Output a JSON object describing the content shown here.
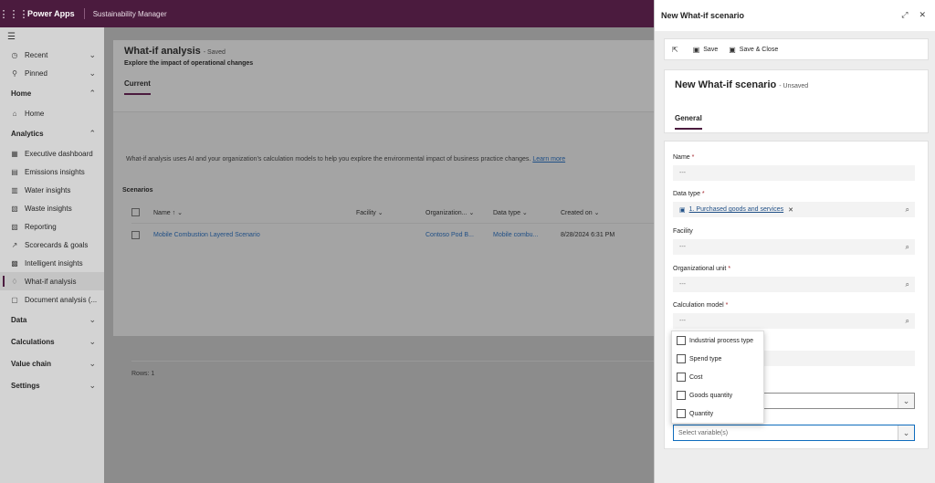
{
  "topbar": {
    "brand": "Power Apps",
    "app": "Sustainability Manager"
  },
  "sidebar": {
    "items": [
      {
        "label": "Recent",
        "icon": "clock-icon",
        "type": "item",
        "chevron": "⌄"
      },
      {
        "label": "Pinned",
        "icon": "pin-icon",
        "type": "item",
        "chevron": "⌄"
      },
      {
        "label": "Home",
        "type": "group",
        "chevron": "⌃"
      },
      {
        "label": "Home",
        "icon": "home-icon",
        "type": "item"
      },
      {
        "label": "Analytics",
        "type": "group",
        "chevron": "⌃"
      },
      {
        "label": "Executive dashboard",
        "icon": "dashboard-icon",
        "type": "item"
      },
      {
        "label": "Emissions insights",
        "icon": "emissions-icon",
        "type": "item"
      },
      {
        "label": "Water insights",
        "icon": "water-icon",
        "type": "item"
      },
      {
        "label": "Waste insights",
        "icon": "waste-icon",
        "type": "item"
      },
      {
        "label": "Reporting",
        "icon": "report-icon",
        "type": "item"
      },
      {
        "label": "Scorecards & goals",
        "icon": "scorecard-icon",
        "type": "item"
      },
      {
        "label": "Intelligent insights",
        "icon": "insights-icon",
        "type": "item"
      },
      {
        "label": "What-if analysis",
        "icon": "bulb-icon",
        "type": "item",
        "active": true
      },
      {
        "label": "Document analysis (...",
        "icon": "document-icon",
        "type": "item"
      },
      {
        "label": "Data",
        "type": "group",
        "chevron": "⌄"
      },
      {
        "label": "Calculations",
        "type": "group",
        "chevron": "⌄"
      },
      {
        "label": "Value chain",
        "type": "group",
        "chevron": "⌄"
      },
      {
        "label": "Settings",
        "type": "group",
        "chevron": "⌄"
      }
    ]
  },
  "main": {
    "title": "What-if analysis",
    "saved": "- Saved",
    "subtitle": "Explore the impact of operational changes",
    "tab": "Current",
    "info": "What-if analysis uses AI and your organization's calculation models to help you explore the environmental impact of business practice changes.",
    "learn_more": "Learn more",
    "scenarios_label": "Scenarios",
    "columns": [
      "Name ↑",
      "Facility",
      "Organization...",
      "Data type",
      "Created on"
    ],
    "rows": [
      [
        "Mobile Combustion Layered Scenario",
        "",
        "Contoso Pod B...",
        "Mobile combu...",
        "8/28/2024 6:31 PM"
      ]
    ],
    "rows_count": "Rows: 1"
  },
  "panel": {
    "header": "New What-if scenario",
    "save": "Save",
    "save_close": "Save & Close",
    "form_title": "New What-if scenario",
    "unsaved": "- Unsaved",
    "tab": "General",
    "fields": {
      "name_label": "Name",
      "name_value": "---",
      "datatype_label": "Data type",
      "datatype_value": "1. Purchased goods and services",
      "facility_label": "Facility",
      "facility_value": "---",
      "orgunit_label": "Organizational unit",
      "orgunit_value": "---",
      "calcmodel_label": "Calculation model",
      "calcmodel_value": "---",
      "variables_placeholder": "Select variable(s)"
    },
    "required_mark": "*"
  },
  "dropdown": {
    "options": [
      "Industrial process type",
      "Spend type",
      "Cost",
      "Goods quantity",
      "Quantity"
    ]
  },
  "colors": {
    "brand": "#4b1b3e",
    "link": "#1f4f86",
    "focus": "#0f6cbd"
  }
}
